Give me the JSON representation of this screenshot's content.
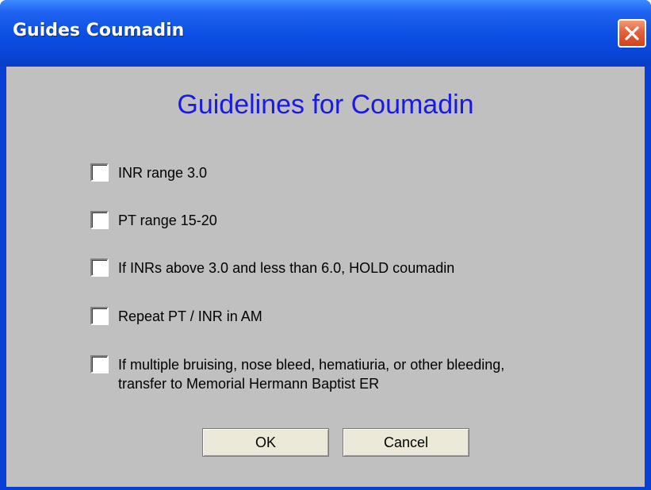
{
  "window": {
    "title": "Guides Coumadin",
    "close_icon": "close-icon"
  },
  "dialog": {
    "heading": "Guidelines for Coumadin",
    "items": [
      {
        "label": "INR range 3.0",
        "checked": false
      },
      {
        "label": "PT range 15-20",
        "checked": false
      },
      {
        "label": "If INRs above 3.0 and less than 6.0, HOLD coumadin",
        "checked": false
      },
      {
        "label": "Repeat PT / INR in AM",
        "checked": false
      },
      {
        "label": "If multiple bruising, nose bleed, hematiuria, or other bleeding,\ntransfer to Memorial Hermann Baptist ER",
        "checked": false
      }
    ],
    "ok_label": "OK",
    "cancel_label": "Cancel"
  },
  "colors": {
    "titlebar": "#0b4ee3",
    "client_bg": "#c0c0c0",
    "heading": "#1a1ae6",
    "close_button": "#e5603c"
  }
}
